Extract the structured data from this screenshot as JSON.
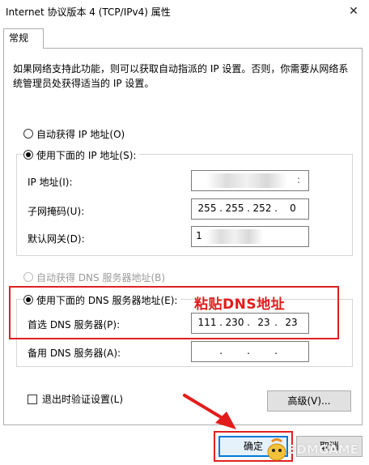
{
  "window": {
    "title": "Internet 协议版本 4 (TCP/IPv4) 属性",
    "close_glyph": "✕"
  },
  "tabs": [
    {
      "label": "常规",
      "selected": true
    }
  ],
  "description": "如果网络支持此功能，则可以获取自动指派的 IP 设置。否则，你需要从网络系统管理员处获得适当的 IP 设置。",
  "ip_section": {
    "auto_label": "自动获得 IP 地址(O)",
    "manual_label": "使用下面的 IP 地址(S):",
    "selected": "manual",
    "fields": [
      {
        "label": "IP 地址(I):",
        "octets": [
          "",
          "",
          "",
          ""
        ],
        "redacted": true
      },
      {
        "label": "子网掩码(U):",
        "octets": [
          "255",
          "255",
          "252",
          "0"
        ]
      },
      {
        "label": "默认网关(D):",
        "octets": [
          "1",
          "",
          "",
          ""
        ],
        "redacted": true
      }
    ]
  },
  "dns_section": {
    "auto_label": "自动获得 DNS 服务器地址(B)",
    "manual_label": "使用下面的 DNS 服务器地址(E):",
    "selected": "manual",
    "fields": [
      {
        "label": "首选 DNS 服务器(P):",
        "octets": [
          "111",
          "230",
          "23",
          "23"
        ]
      },
      {
        "label": "备用 DNS 服务器(A):",
        "octets": [
          "",
          "",
          "",
          ""
        ]
      }
    ]
  },
  "validate_label": "退出时验证设置(L)",
  "validate_checked": false,
  "buttons": {
    "advanced": "高级(V)...",
    "ok": "确定",
    "cancel": "取消"
  },
  "annotation": {
    "text": "粘贴DNS地址",
    "color": "#e02020"
  },
  "watermark": {
    "text": "3DMGAME"
  }
}
